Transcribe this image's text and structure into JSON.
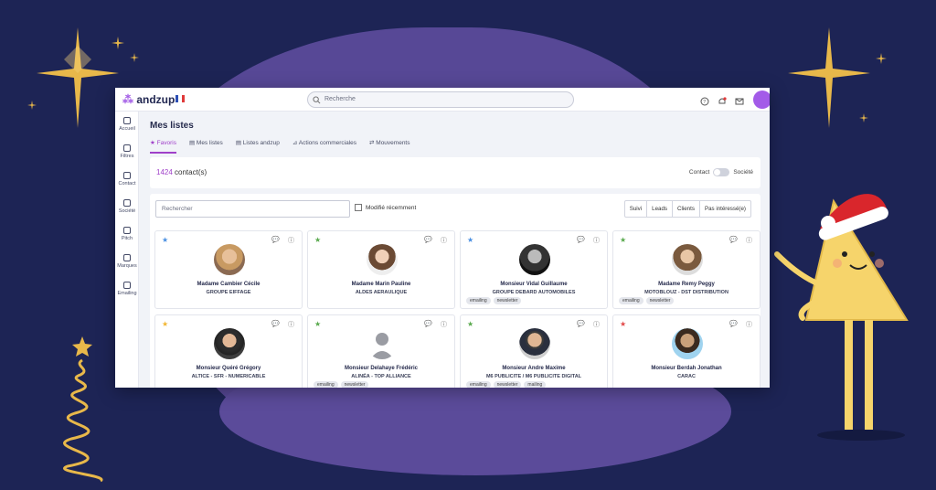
{
  "brand": {
    "name": "andzup",
    "accent": "#a040c9"
  },
  "search": {
    "placeholder": "Recherche"
  },
  "sidebar": {
    "items": [
      {
        "label": "Accueil"
      },
      {
        "label": "Filtres"
      },
      {
        "label": "Contact"
      },
      {
        "label": "Société"
      },
      {
        "label": "Pitch"
      },
      {
        "label": "Marques"
      },
      {
        "label": "Emailing"
      }
    ]
  },
  "page": {
    "title": "Mes listes"
  },
  "tabs": [
    {
      "label": "Favoris",
      "icon": "star-icon"
    },
    {
      "label": "Mes listes",
      "icon": "list-icon"
    },
    {
      "label": "Listes andzup",
      "icon": "list-icon"
    },
    {
      "label": "Actions commerciales",
      "icon": "chart-icon"
    },
    {
      "label": "Mouvements",
      "icon": "move-icon"
    }
  ],
  "summary": {
    "count": "1424",
    "count_suffix": " contact(s)",
    "toggle_left": "Contact",
    "toggle_right": "Société"
  },
  "filters": {
    "search_placeholder": "Rechercher",
    "recent_label": "Modifié récemment",
    "buttons": [
      "Suivi",
      "Leads",
      "Clients",
      "Pas intéressé(e)"
    ]
  },
  "cards": [
    {
      "name": "Madame Cambier Cécile",
      "company": "GROUPE EIFFAGE",
      "star": "#4a90e2",
      "tags": []
    },
    {
      "name": "Madame Marin Pauline",
      "company": "ALDES AERAULIQUE",
      "star": "#5aaa4e",
      "tags": []
    },
    {
      "name": "Monsieur Vidal Guillaume",
      "company": "GROUPE DEBARD AUTOMOBILES",
      "star": "#4a90e2",
      "tags": [
        "emailing",
        "newsletter"
      ]
    },
    {
      "name": "Madame Remy Peggy",
      "company": "MOTOBLOUZ - DST DISTRIBUTION",
      "star": "#5aaa4e",
      "tags": [
        "emailing",
        "newsletter"
      ]
    },
    {
      "name": "Monsieur Quéré Grégory",
      "company": "ALTICE - SFR - NUMERICABLE",
      "star": "#f2b632",
      "tags": []
    },
    {
      "name": "Monsieur Delahaye Frédéric",
      "company": "ALINÉA - TOP ALLIANCE",
      "star": "#5aaa4e",
      "tags": [
        "emailing",
        "newsletter"
      ]
    },
    {
      "name": "Monsieur Andre Maxime",
      "company": "M6 PUBLICITE / M6 PUBLICITE DIGITAL",
      "star": "#5aaa4e",
      "tags": [
        "emailing",
        "newsletter",
        "mailing"
      ]
    },
    {
      "name": "Monsieur Berdah Jonathan",
      "company": "CARAC",
      "star": "#e24a4a",
      "tags": []
    }
  ]
}
